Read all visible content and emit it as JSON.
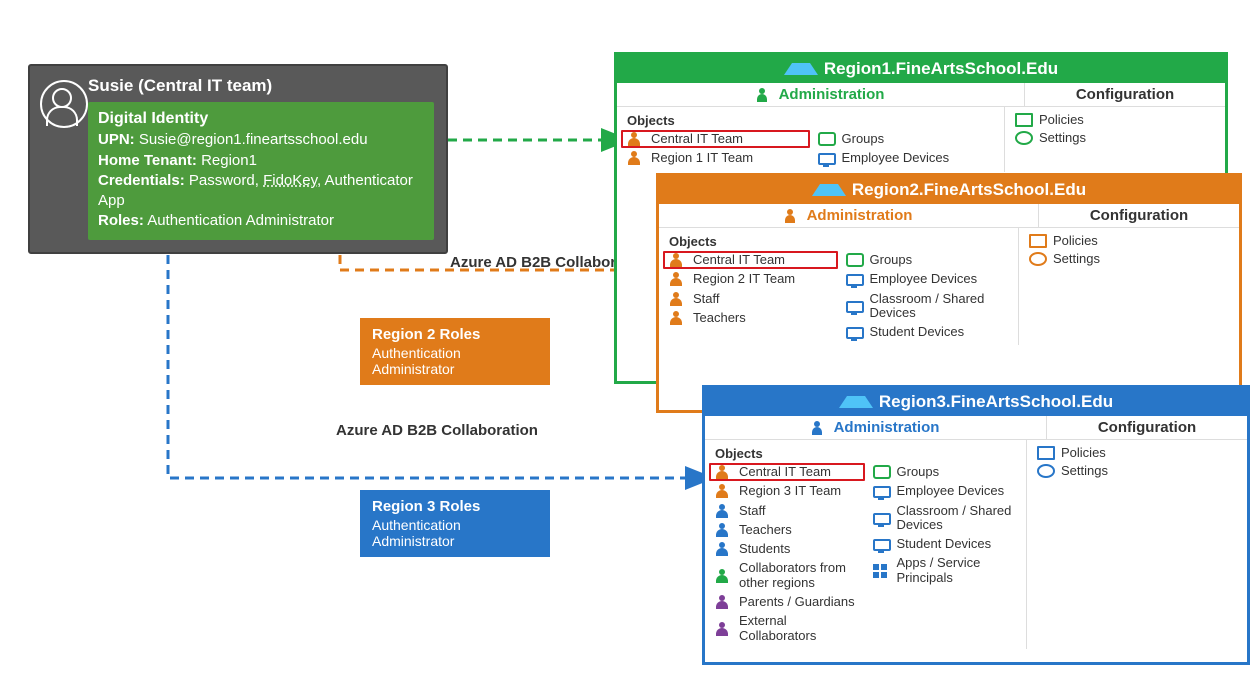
{
  "identity": {
    "title": "Susie (Central IT team)",
    "section": "Digital Identity",
    "upn_label": "UPN:",
    "upn": "Susie@region1.fineartsschool.edu",
    "home_label": "Home Tenant:",
    "home": "Region1",
    "cred_label": "Credentials:",
    "cred_pre": "Password, ",
    "cred_fido": "FidoKey",
    "cred_post": ", Authenticator App",
    "roles_label": "Roles:",
    "roles": "Authentication Administrator"
  },
  "b2b_label": "Azure AD B2B Collaboration",
  "roles_r2": {
    "title": "Region 2 Roles",
    "role": "Authentication Administrator"
  },
  "roles_r3": {
    "title": "Region 3 Roles",
    "role": "Authentication Administrator"
  },
  "tenant": {
    "admin": "Administration",
    "config": "Configuration",
    "objects": "Objects",
    "policies": "Policies",
    "settings": "Settings"
  },
  "r1": {
    "title": "Region1.FineArtsSchool.Edu",
    "left": [
      "Central IT Team",
      "Region 1 IT Team"
    ],
    "right": [
      "Groups",
      "Employee Devices"
    ]
  },
  "r2": {
    "title": "Region2.FineArtsSchool.Edu",
    "left": [
      "Central IT Team",
      "Region 2 IT Team",
      "Staff",
      "Teachers"
    ],
    "right": [
      "Groups",
      "Employee Devices",
      "Classroom / Shared Devices",
      "Student Devices"
    ]
  },
  "r3": {
    "title": "Region3.FineArtsSchool.Edu",
    "left": [
      "Central IT Team",
      "Region 3 IT Team",
      "Staff",
      "Teachers",
      "Students",
      "Collaborators from other regions",
      "Parents / Guardians",
      "External Collaborators"
    ],
    "right": [
      "Groups",
      "Employee Devices",
      "Classroom / Shared Devices",
      "Student Devices",
      "Apps / Service Principals"
    ]
  },
  "colors": {
    "r1": "#22a948",
    "r2": "#e07b1a",
    "r3": "#2876c8"
  }
}
